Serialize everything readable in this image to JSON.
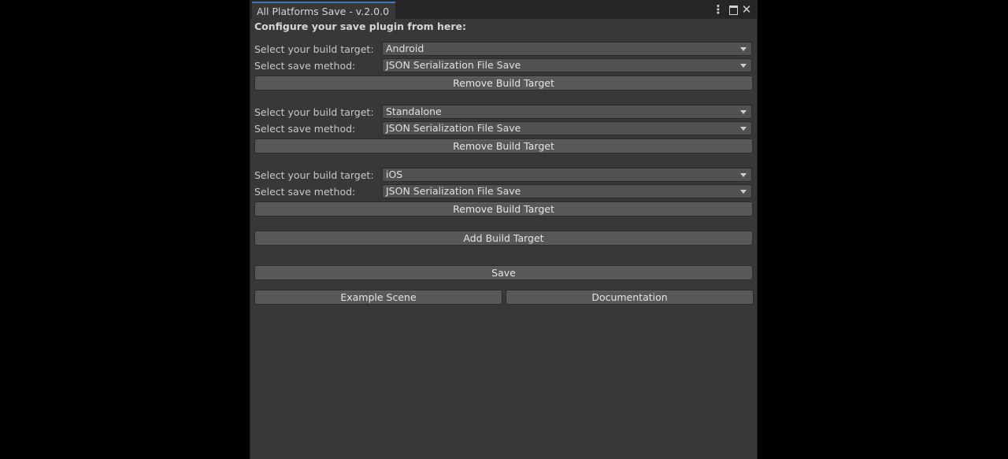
{
  "window": {
    "title": "All Platforms Save - v.2.0.0",
    "heading": "Configure your save plugin from here:"
  },
  "labels": {
    "build_target": "Select your build target:",
    "save_method": "Select save method:"
  },
  "groups": [
    {
      "build_target": "Android",
      "save_method": "JSON Serialization File Save",
      "remove_label": "Remove Build Target"
    },
    {
      "build_target": "Standalone",
      "save_method": "JSON Serialization File Save",
      "remove_label": "Remove Build Target"
    },
    {
      "build_target": "iOS",
      "save_method": "JSON Serialization File Save",
      "remove_label": "Remove Build Target"
    }
  ],
  "buttons": {
    "add_build_target": "Add Build Target",
    "save": "Save",
    "example_scene": "Example Scene",
    "documentation": "Documentation"
  },
  "icons": {
    "menu": "kebab-menu-icon",
    "maximize": "maximize-icon",
    "close": "close-icon"
  }
}
